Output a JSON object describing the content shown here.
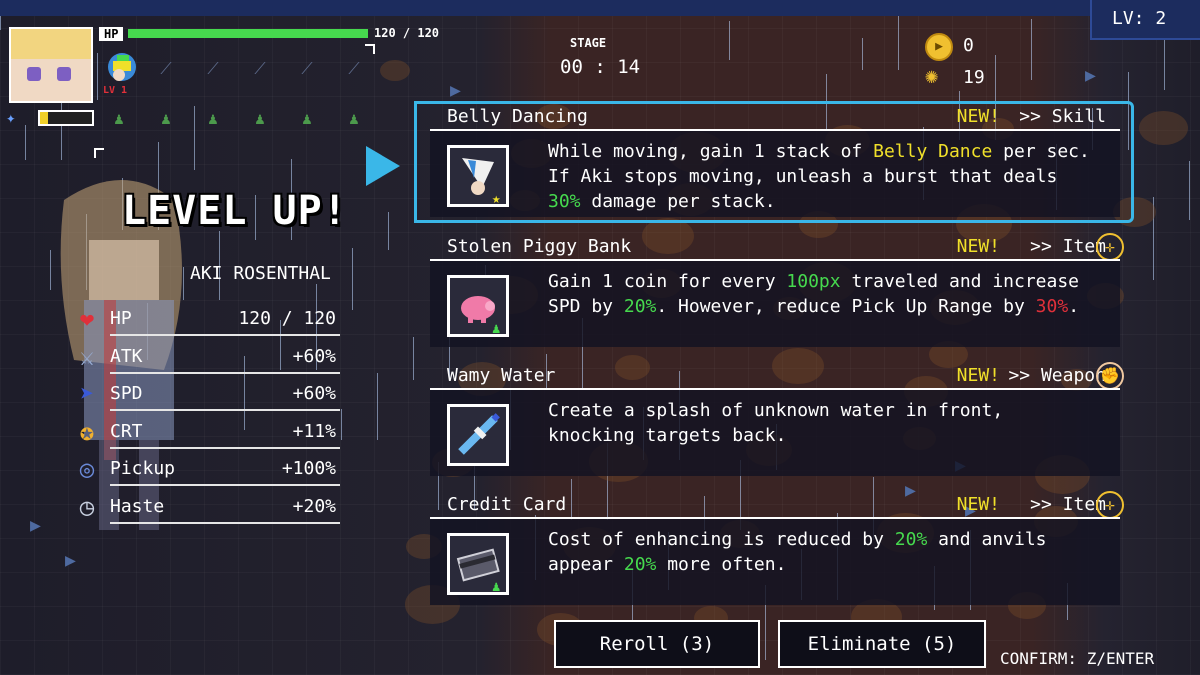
{
  "hud": {
    "level": "LV: 2",
    "hp_label": "HP",
    "hp_value": "120 / 120",
    "hp_fraction": 1.0,
    "weapon_level": "LV 1",
    "exp_fraction": 0.15,
    "stage_label": "STAGE",
    "stage_time": "00 : 14",
    "coins": "0",
    "kills": "19"
  },
  "character": {
    "level_up": "LEVEL UP!",
    "name": "AKI ROSENTHAL",
    "stats": [
      {
        "name": "HP",
        "value": "120 / 120",
        "icon": "heart-icon",
        "color": "#e0303a",
        "glyph": "❤"
      },
      {
        "name": "ATK",
        "value": "+60%",
        "icon": "sword-icon",
        "color": "#9ab0d8",
        "glyph": "⚔"
      },
      {
        "name": "SPD",
        "value": "+60%",
        "icon": "boot-icon",
        "color": "#3a5ad8",
        "glyph": "➤"
      },
      {
        "name": "CRT",
        "value": "+11%",
        "icon": "crit-icon",
        "color": "#f0b030",
        "glyph": "✪"
      },
      {
        "name": "Pickup",
        "value": "+100%",
        "icon": "magnet-icon",
        "color": "#6a8ad8",
        "glyph": "◎"
      },
      {
        "name": "Haste",
        "value": "+20%",
        "icon": "clock-icon",
        "color": "#c8d0e0",
        "glyph": "◷"
      }
    ]
  },
  "cards": [
    {
      "title": "Belly Dancing",
      "new_label": "NEW!",
      "type": ">> Skill",
      "icon": "belly-dance-skill-icon",
      "badge_icon": "star-icon",
      "line1": [
        "While moving, gain 1 stack of ",
        "Belly Dance",
        " per sec."
      ],
      "line2": "If Aki stops moving, unleash a burst that deals",
      "line3": [
        "30%",
        " damage per stack."
      ]
    },
    {
      "title": "Stolen Piggy Bank",
      "new_label": "NEW!",
      "type": ">> Item",
      "icon": "piggy-bank-icon",
      "badge_icon": "shirt-icon",
      "line1": [
        "Gain 1 coin for every ",
        "100px",
        " traveled and increase"
      ],
      "line2": [
        "SPD by ",
        "20%",
        ". However, reduce Pick Up Range by ",
        "30%",
        "."
      ]
    },
    {
      "title": "Wamy Water",
      "new_label": "NEW!",
      "type": ">> Weapon",
      "icon": "water-bottle-icon",
      "line1": "Create a splash of unknown water in front,",
      "line2": "knocking targets back."
    },
    {
      "title": "Credit Card",
      "new_label": "NEW!",
      "type": ">> Item",
      "icon": "credit-card-icon",
      "badge_icon": "shirt-icon",
      "line1": [
        "Cost of enhancing is reduced by ",
        "20%",
        " and anvils"
      ],
      "line2": [
        "appear ",
        "20%",
        " more often."
      ]
    }
  ],
  "buttons": {
    "reroll": "Reroll (3)",
    "eliminate": "Eliminate (5)",
    "confirm_hint": "CONFIRM: Z/ENTER"
  },
  "colors": {
    "accent": "#3ab7e8",
    "highlight_green": "#46d94e",
    "highlight_yellow": "#f0e02a",
    "highlight_red": "#e0303a"
  }
}
